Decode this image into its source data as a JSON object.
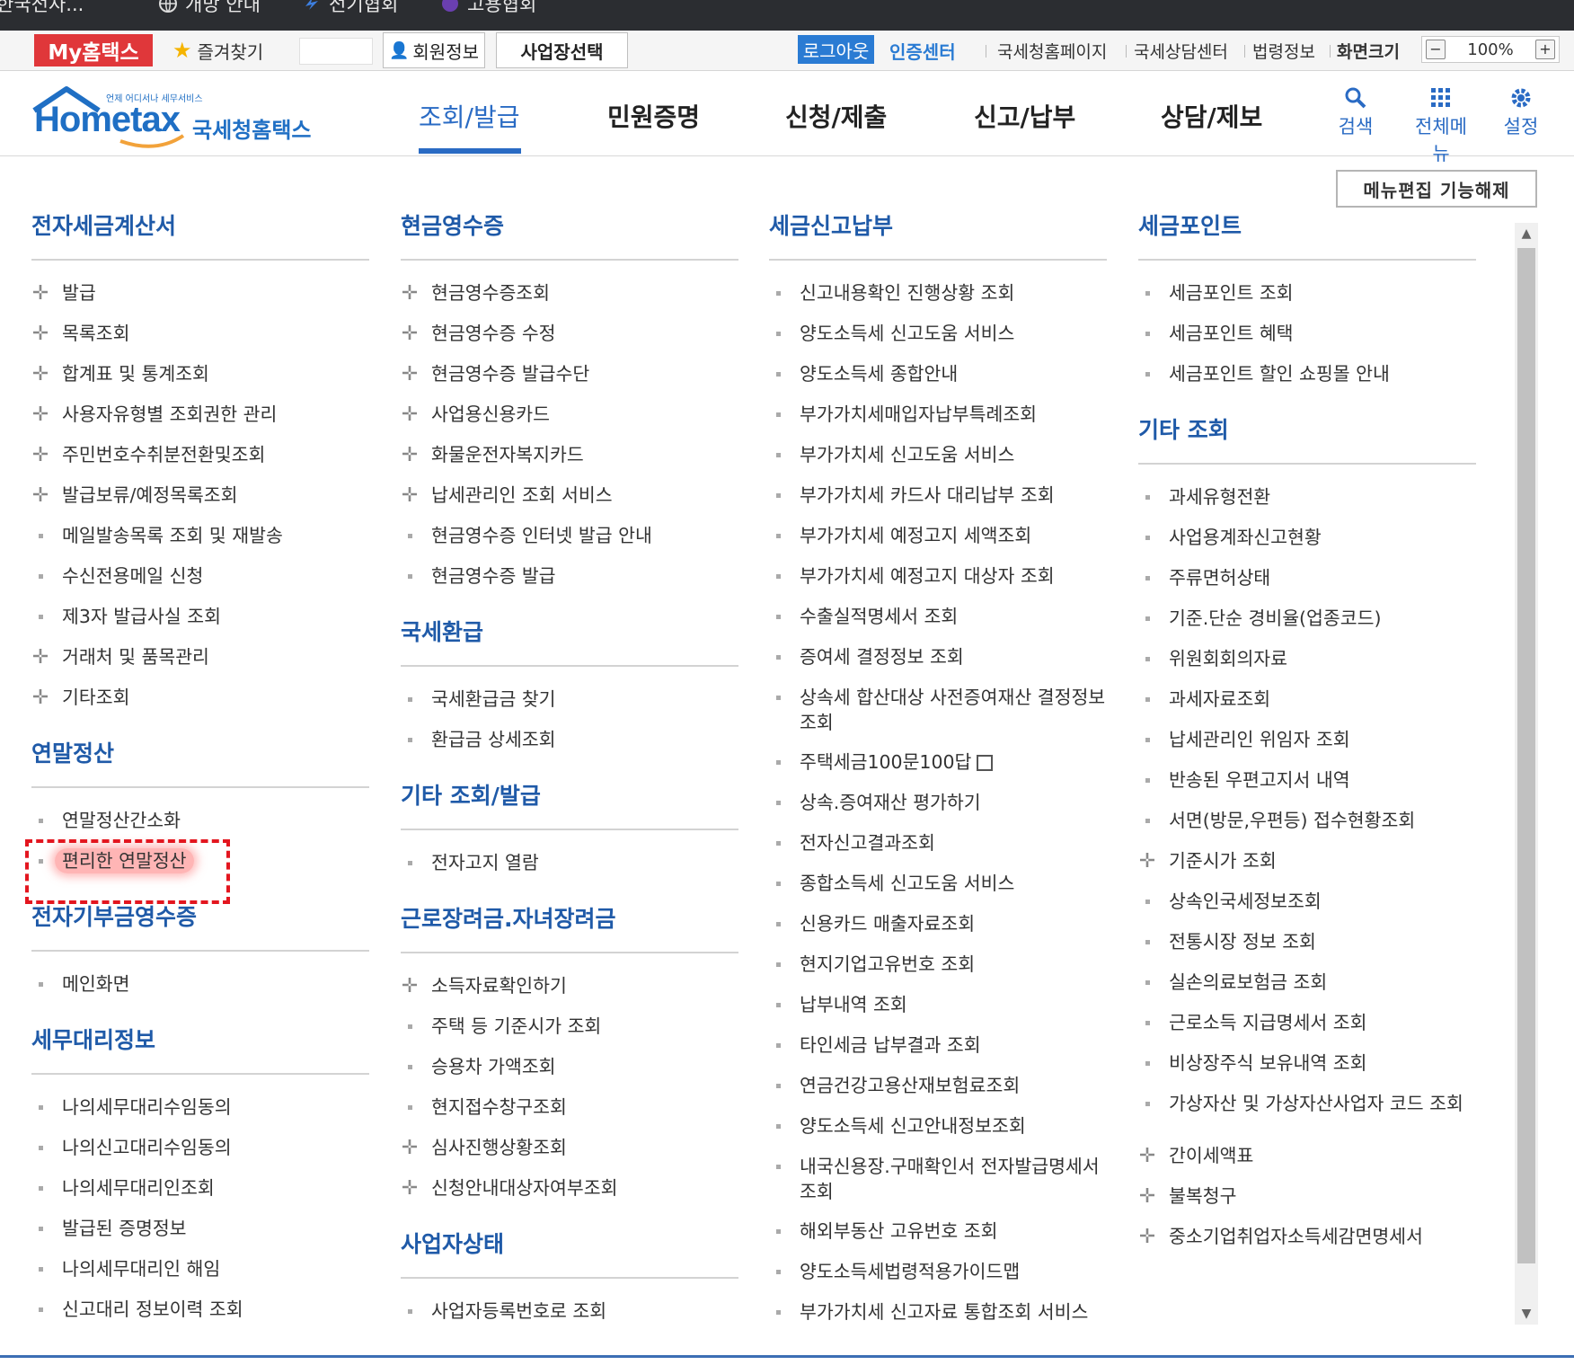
{
  "bookmarks": [
    {
      "label": "한국전자...",
      "icon": "bookmark-icon"
    },
    {
      "label": "개방 안내",
      "icon": "globe-icon"
    },
    {
      "label": "전기협회",
      "icon": "bolt-icon"
    },
    {
      "label": "고용협회",
      "icon": "circle-icon"
    }
  ],
  "utility": {
    "my_hometax": "My홈택스",
    "favorites": "즐겨찾기",
    "member_info": "회원정보",
    "business_select": "사업장선택",
    "logout": "로그아웃",
    "cert_center": "인증센터",
    "links": [
      "국세청홈페이지",
      "국세상담센터",
      "법령정보",
      "화면크기"
    ],
    "zoom": "100%"
  },
  "header": {
    "logo_small": "언제 어디서나 세무서비스",
    "logo_main": "Hometax",
    "logo_korean": "국세청홈택스",
    "nav": [
      "조회/발급",
      "민원증명",
      "신청/제출",
      "신고/납부",
      "상담/제보"
    ],
    "active_nav": 0,
    "tools": {
      "search": "검색",
      "all_menu": "전체메뉴",
      "settings": "설정"
    }
  },
  "menu_edit_button": "메뉴편집 기능해제",
  "columns": [
    {
      "sections": [
        {
          "title": "전자세금계산서",
          "items": [
            {
              "label": "발급",
              "type": "plus"
            },
            {
              "label": "목록조회",
              "type": "plus"
            },
            {
              "label": "합계표 및 통계조회",
              "type": "plus"
            },
            {
              "label": "사용자유형별 조회권한 관리",
              "type": "plus"
            },
            {
              "label": "주민번호수취분전환및조회",
              "type": "plus"
            },
            {
              "label": "발급보류/예정목록조회",
              "type": "plus"
            },
            {
              "label": "메일발송목록 조회 및 재발송",
              "type": "dot"
            },
            {
              "label": "수신전용메일 신청",
              "type": "dot"
            },
            {
              "label": "제3자 발급사실 조회",
              "type": "dot"
            },
            {
              "label": "거래처 및 품목관리",
              "type": "plus"
            },
            {
              "label": "기타조회",
              "type": "plus"
            }
          ]
        },
        {
          "title": "연말정산",
          "items": [
            {
              "label": "연말정산간소화",
              "type": "dot"
            },
            {
              "label": "편리한 연말정산",
              "type": "dot",
              "highlight": true
            }
          ]
        },
        {
          "title": "전자기부금영수증",
          "items": [
            {
              "label": "메인화면",
              "type": "dot"
            }
          ]
        },
        {
          "title": "세무대리정보",
          "items": [
            {
              "label": "나의세무대리수임동의",
              "type": "dot"
            },
            {
              "label": "나의신고대리수임동의",
              "type": "dot"
            },
            {
              "label": "나의세무대리인조회",
              "type": "dot"
            },
            {
              "label": "발급된 증명정보",
              "type": "dot"
            },
            {
              "label": "나의세무대리인 해임",
              "type": "dot"
            },
            {
              "label": "신고대리 정보이력 조회",
              "type": "dot"
            }
          ]
        }
      ]
    },
    {
      "sections": [
        {
          "title": "현금영수증",
          "items": [
            {
              "label": "현금영수증조회",
              "type": "plus"
            },
            {
              "label": "현금영수증 수정",
              "type": "plus"
            },
            {
              "label": "현금영수증 발급수단",
              "type": "plus"
            },
            {
              "label": "사업용신용카드",
              "type": "plus"
            },
            {
              "label": "화물운전자복지카드",
              "type": "plus"
            },
            {
              "label": "납세관리인 조회 서비스",
              "type": "plus"
            },
            {
              "label": "현금영수증 인터넷 발급 안내",
              "type": "dot"
            },
            {
              "label": "현금영수증 발급",
              "type": "dot"
            }
          ]
        },
        {
          "title": "국세환급",
          "items": [
            {
              "label": "국세환급금 찾기",
              "type": "dot"
            },
            {
              "label": "환급금 상세조회",
              "type": "dot"
            }
          ]
        },
        {
          "title": "기타 조회/발급",
          "items": [
            {
              "label": "전자고지 열람",
              "type": "dot"
            }
          ]
        },
        {
          "title": "근로장려금.자녀장려금",
          "items": [
            {
              "label": "소득자료확인하기",
              "type": "plus"
            },
            {
              "label": "주택 등 기준시가 조회",
              "type": "dot"
            },
            {
              "label": "승용차 가액조회",
              "type": "dot"
            },
            {
              "label": "현지접수창구조회",
              "type": "dot"
            },
            {
              "label": "심사진행상황조회",
              "type": "plus"
            },
            {
              "label": "신청안내대상자여부조회",
              "type": "plus"
            }
          ]
        },
        {
          "title": "사업자상태",
          "items": [
            {
              "label": "사업자등록번호로 조회",
              "type": "dot"
            }
          ]
        }
      ]
    },
    {
      "sections": [
        {
          "title": "세금신고납부",
          "items": [
            {
              "label": "신고내용확인 진행상황 조회",
              "type": "dot"
            },
            {
              "label": "양도소득세 신고도움 서비스",
              "type": "dot"
            },
            {
              "label": "양도소득세 종합안내",
              "type": "dot"
            },
            {
              "label": "부가가치세매입자납부특례조회",
              "type": "dot"
            },
            {
              "label": "부가가치세 신고도움 서비스",
              "type": "dot"
            },
            {
              "label": "부가가치세 카드사 대리납부 조회",
              "type": "dot"
            },
            {
              "label": "부가가치세 예정고지 세액조회",
              "type": "dot"
            },
            {
              "label": "부가가치세 예정고지 대상자 조회",
              "type": "dot"
            },
            {
              "label": "수출실적명세서 조회",
              "type": "dot"
            },
            {
              "label": "증여세 결정정보 조회",
              "type": "dot"
            },
            {
              "label": "상속세 합산대상 사전증여재산 결정정보 조회",
              "type": "dot",
              "tall": true
            },
            {
              "label": "주택세금100문100답",
              "type": "dot",
              "external": true
            },
            {
              "label": "상속.증여재산 평가하기",
              "type": "dot"
            },
            {
              "label": "전자신고결과조회",
              "type": "dot"
            },
            {
              "label": "종합소득세 신고도움 서비스",
              "type": "dot"
            },
            {
              "label": "신용카드 매출자료조회",
              "type": "dot"
            },
            {
              "label": "현지기업고유번호 조회",
              "type": "dot"
            },
            {
              "label": "납부내역 조회",
              "type": "dot"
            },
            {
              "label": "타인세금 납부결과 조회",
              "type": "dot"
            },
            {
              "label": "연금건강고용산재보험료조회",
              "type": "dot"
            },
            {
              "label": "양도소득세 신고안내정보조회",
              "type": "dot"
            },
            {
              "label": "내국신용장.구매확인서 전자발급명세서 조회",
              "type": "dot",
              "tall": true
            },
            {
              "label": "해외부동산 고유번호 조회",
              "type": "dot"
            },
            {
              "label": "양도소득세법령적용가이드맵",
              "type": "dot"
            },
            {
              "label": "부가가치세 신고자료 통합조회 서비스",
              "type": "dot"
            }
          ]
        }
      ]
    },
    {
      "sections": [
        {
          "title": "세금포인트",
          "items": [
            {
              "label": "세금포인트 조회",
              "type": "dot"
            },
            {
              "label": "세금포인트 혜택",
              "type": "dot"
            },
            {
              "label": "세금포인트 할인 쇼핑몰 안내",
              "type": "dot"
            }
          ]
        },
        {
          "title": "기타 조회",
          "items": [
            {
              "label": "과세유형전환",
              "type": "dot"
            },
            {
              "label": "사업용계좌신고현황",
              "type": "dot"
            },
            {
              "label": "주류면허상태",
              "type": "dot"
            },
            {
              "label": "기준.단순 경비율(업종코드)",
              "type": "dot"
            },
            {
              "label": "위원회회의자료",
              "type": "dot"
            },
            {
              "label": "과세자료조회",
              "type": "dot"
            },
            {
              "label": "납세관리인 위임자 조회",
              "type": "dot"
            },
            {
              "label": "반송된 우편고지서 내역",
              "type": "dot"
            },
            {
              "label": "서면(방문,우편등) 접수현황조회",
              "type": "dot"
            },
            {
              "label": "기준시가 조회",
              "type": "plus"
            },
            {
              "label": "상속인국세정보조회",
              "type": "dot"
            },
            {
              "label": "전통시장 정보 조회",
              "type": "dot"
            },
            {
              "label": "실손의료보험금 조회",
              "type": "dot"
            },
            {
              "label": "근로소득 지급명세서 조회",
              "type": "dot"
            },
            {
              "label": "비상장주식 보유내역 조회",
              "type": "dot"
            },
            {
              "label": "가상자산 및 가상자산사업자 코드 조회",
              "type": "dot",
              "tall": true
            },
            {
              "label": "간이세액표",
              "type": "plus"
            },
            {
              "label": "불복청구",
              "type": "plus"
            },
            {
              "label": "중소기업취업자소득세감면명세서",
              "type": "plus"
            }
          ]
        }
      ]
    }
  ]
}
